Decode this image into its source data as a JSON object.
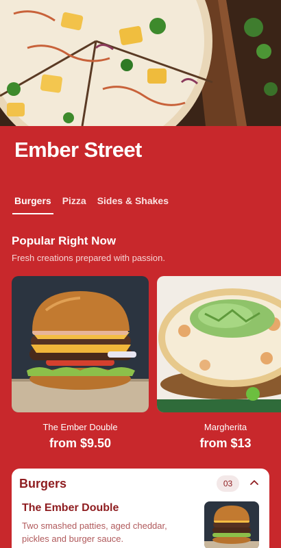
{
  "app": {
    "title": "Ember Street"
  },
  "tabs": [
    {
      "label": "Burgers",
      "active": true
    },
    {
      "label": "Pizza",
      "active": false
    },
    {
      "label": "Sides & Shakes",
      "active": false
    }
  ],
  "popular": {
    "title": "Popular Right Now",
    "subtitle": "Fresh creations prepared with passion.",
    "items": [
      {
        "name": "The Ember Double",
        "price": "from $9.50"
      },
      {
        "name": "Margherita",
        "price": "from $13"
      }
    ]
  },
  "menu_section": {
    "title": "Burgers",
    "count": "03",
    "items": [
      {
        "name": "The Ember Double",
        "description": "Two smashed patties, aged cheddar, pickles and burger sauce."
      }
    ]
  },
  "colors": {
    "brand_red": "#c8282c",
    "dark_red": "#8e1c1f",
    "panel_bg": "#ffffff"
  },
  "icons": {
    "collapse": "chevron-up-icon"
  }
}
